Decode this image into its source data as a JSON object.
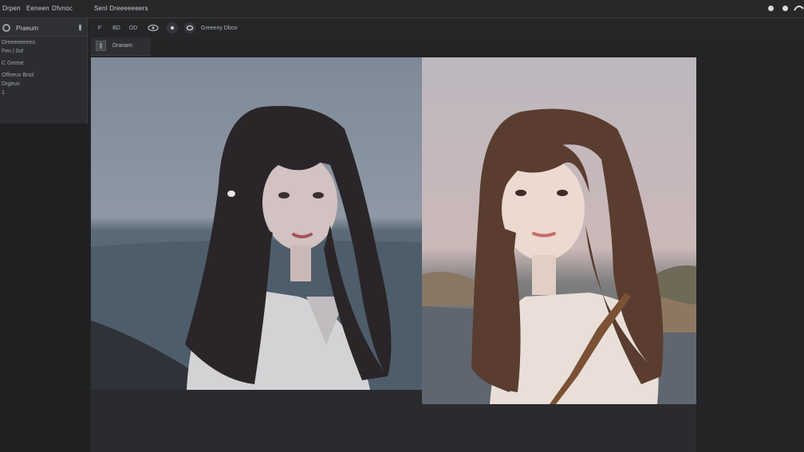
{
  "menu": {
    "items": [
      "Drpen",
      "Eeneen",
      "Dfvnoc",
      "Senl Dreeeeeeers"
    ]
  },
  "toolbar": {
    "buttons": [
      "F",
      "BD",
      "OD",
      "",
      "",
      ""
    ],
    "label": "Greeeny Dboo"
  },
  "sidebar": {
    "title": "Praeum",
    "line1": "Dreeeeeeees",
    "line2": "Fen | 0xf",
    "line3": "C Geose",
    "line4": "Offeeux Bnol",
    "line5": "Drgeux",
    "line6": "1"
  },
  "tab": {
    "label": "Dranam"
  },
  "canvas": {
    "left_image": "portrait-dark-hair",
    "right_image": "portrait-brown-hair"
  },
  "colors": {
    "app_bg": "#232426",
    "panel_bg": "#2c2d30",
    "text": "#b9bbbe"
  }
}
